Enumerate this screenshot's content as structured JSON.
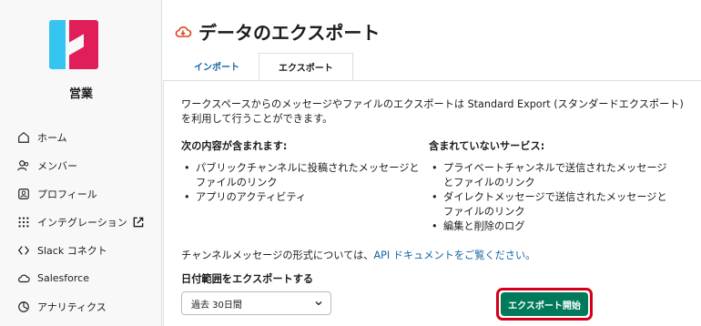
{
  "sidebar": {
    "workspace_name": "営業",
    "items": [
      {
        "label": "ホーム",
        "icon": "home-icon"
      },
      {
        "label": "メンバー",
        "icon": "members-icon"
      },
      {
        "label": "プロフィール",
        "icon": "profile-icon"
      },
      {
        "label": "インテグレーション",
        "icon": "integrations-icon",
        "external": true
      },
      {
        "label": "Slack コネクト",
        "icon": "slack-connect-icon"
      },
      {
        "label": "Salesforce",
        "icon": "cloud-icon"
      },
      {
        "label": "アナリティクス",
        "icon": "analytics-icon"
      }
    ]
  },
  "page": {
    "title": "データのエクスポート",
    "title_icon": "export-cloud-icon"
  },
  "tabs": [
    {
      "label": "インポート",
      "active": false
    },
    {
      "label": "エクスポート",
      "active": true
    }
  ],
  "content": {
    "intro": "ワークスペースからのメッセージやファイルのエクスポートは Standard Export (スタンダードエクスポート) を利用して行うことができます。",
    "included": {
      "heading": "次の内容が含まれます:",
      "items": [
        "パブリックチャンネルに投稿されたメッセージとファイルのリンク",
        "アプリのアクティビティ"
      ]
    },
    "excluded": {
      "heading": "含まれていないサービス:",
      "items": [
        "プライベートチャンネルで送信されたメッセージとファイルのリンク",
        "ダイレクトメッセージで送信されたメッセージとファイルのリンク",
        "編集と削除のログ"
      ]
    },
    "channel_note_prefix": "チャンネルメッセージの形式については、",
    "channel_note_link": "API ドキュメントをご覧ください。",
    "range_label": "日付範囲をエクスポートする",
    "range_select_value": "過去 30日間",
    "export_button": "エクスポート開始"
  },
  "colors": {
    "accent_link": "#1264a3",
    "export_button": "#007a5a",
    "highlight_border": "#d4001a",
    "title_icon": "#e0401a"
  }
}
